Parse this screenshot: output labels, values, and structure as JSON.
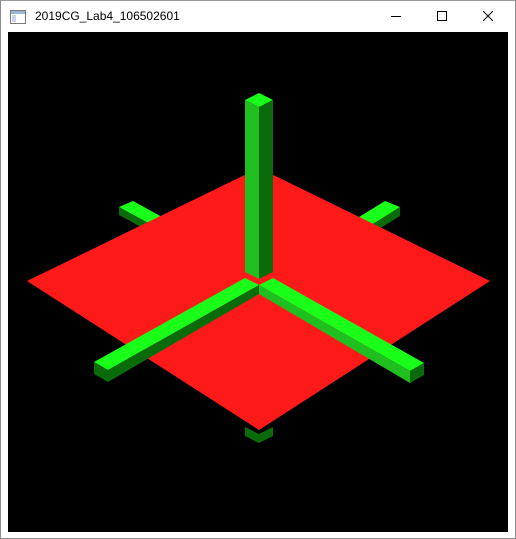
{
  "window": {
    "title": "2019CG_Lab4_106502601",
    "icon": "app-window-icon",
    "controls": [
      "minimize-icon",
      "maximize-icon",
      "close-icon"
    ]
  },
  "scene": {
    "background_color": "#000000",
    "plane_color": "#ff1a1a",
    "axis_bright_color": "#1aff1a",
    "axis_mid_color": "#1fbf1f",
    "axis_dark_color": "#0a6b0a"
  }
}
